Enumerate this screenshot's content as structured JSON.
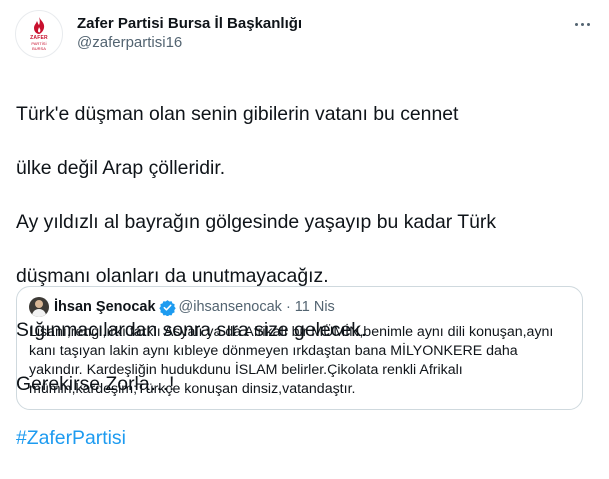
{
  "author": {
    "display_name": "Zafer Partisi Bursa İl Başkanlığı",
    "handle": "@zaferpartisi16",
    "logo_text": "ZAFER",
    "logo_sub": "PARTİSİ",
    "logo_city": "BURSA"
  },
  "tweet": {
    "lines": [
      "Türk'e düşman olan senin gibilerin vatanı bu cennet",
      "ülke değil Arap çölleridir.",
      "Ay yıldızlı al bayrağın gölgesinde yaşayıp bu kadar Türk",
      "düşmanı olanları da unutmayacağız.",
      "Sığınmacılardan sonra sıra size gelecek.",
      "Gerekirse Zorla…!"
    ],
    "hashtag": "#ZaferPartisi"
  },
  "quoted": {
    "name": "İhsan Şenocak",
    "handle": "@ihsansenocak",
    "dot": "·",
    "date": "11 Nis",
    "text": "Lisanı,rengi,ırkı farklı Asyalı ya da Afrikalı bir MÜMİN,benimle aynı dili konuşan,aynı kanı taşıyan lakin aynı kıbleye dönmeyen ırkdaştan bana MİLYONKERE daha yakındır. Kardeşliğin hudukdunu İSLAM belirler.Çikolata renkli Afrikalı mümin,kardeşim;Türkçe konuşan dinsiz,vatandaştır."
  },
  "icons": {
    "more": "more-horizontal-icon",
    "verified": "verified-badge-icon"
  },
  "colors": {
    "accent": "#1d9bf0",
    "secondary_text": "#536471",
    "logo_red": "#c8102e"
  }
}
